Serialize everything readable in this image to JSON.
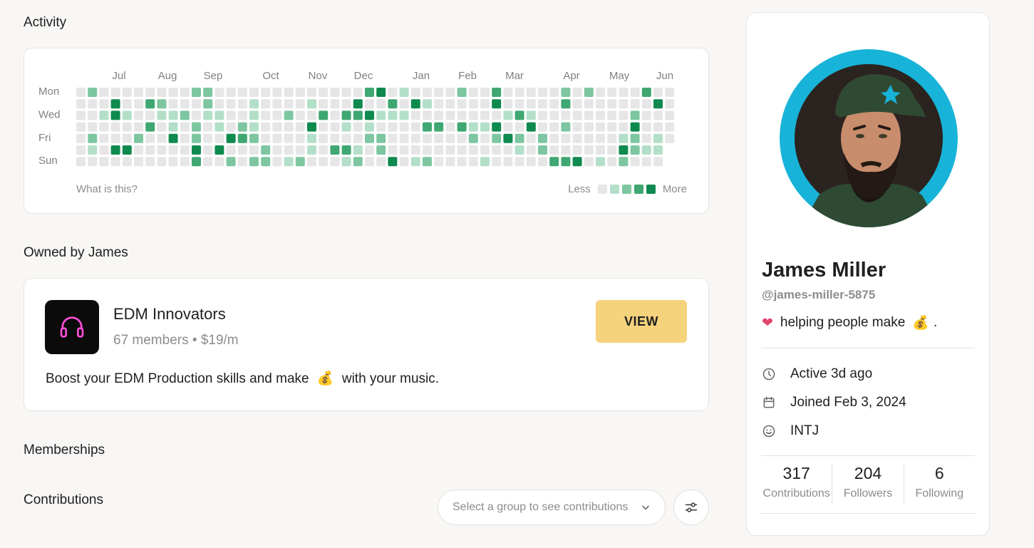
{
  "sections": {
    "activity": "Activity",
    "owned": "Owned by James",
    "memberships": "Memberships",
    "contributions": "Contributions"
  },
  "activity": {
    "months": [
      "Jul",
      "Aug",
      "Sep",
      "Oct",
      "Nov",
      "Dec",
      "Jan",
      "Feb",
      "Mar",
      "Apr",
      "May",
      "Jun"
    ],
    "days": [
      "Mon",
      "Wed",
      "Fri",
      "Sun"
    ],
    "what_is_this": "What is this?",
    "legend_less": "Less",
    "legend_more": "More",
    "colors": [
      "#e6e6e6",
      "#b3dfc8",
      "#7dc6a0",
      "#3fa772",
      "#0f8a4e"
    ]
  },
  "group": {
    "name": "EDM Innovators",
    "meta": "67 members • $19/m",
    "view_label": "VIEW",
    "description_before": "Boost your EDM Production skills and make",
    "description_emoji": "💰",
    "description_after": "with your music.",
    "icon": "headphones-icon"
  },
  "contributions": {
    "select_placeholder": "Select a group to see contributions"
  },
  "profile": {
    "name": "James Miller",
    "handle": "@james-miller-5875",
    "bio_heart": "❤",
    "bio_text": "helping people make",
    "bio_emoji": "💰",
    "bio_end": ".",
    "active": "Active 3d ago",
    "joined": "Joined Feb 3, 2024",
    "type": "INTJ",
    "stats": [
      {
        "value": "317",
        "label": "Contributions"
      },
      {
        "value": "204",
        "label": "Followers"
      },
      {
        "value": "6",
        "label": "Following"
      }
    ]
  },
  "accent": "#f5d27c"
}
